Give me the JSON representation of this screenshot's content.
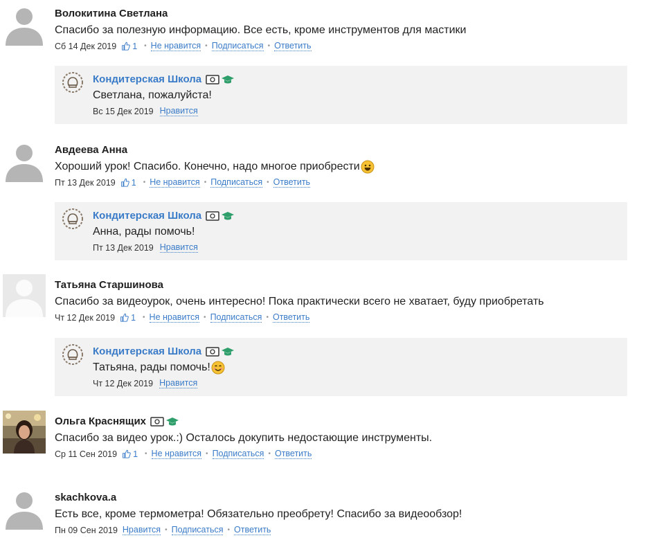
{
  "comments": [
    {
      "author": "Волокитина Светлана",
      "text": "Спасибо за полезную информацию. Все есть, кроме инструментов для мастики",
      "date": "Сб 14 Дек 2019",
      "likes": "1",
      "dislike_label": "Не нравится",
      "subscribe_label": "Подписаться",
      "reply_label": "Ответить",
      "reply": {
        "author": "Кондитерская Школа",
        "text": "Светлана, пожалуйста!",
        "date": "Вс 15 Дек 2019",
        "like_label": "Нравится"
      }
    },
    {
      "author": "Авдеева Анна",
      "text": "Хороший урок! Спасибо. Конечно, надо многое приобрести",
      "date": "Пт 13 Дек 2019",
      "likes": "1",
      "dislike_label": "Не нравится",
      "subscribe_label": "Подписаться",
      "reply_label": "Ответить",
      "reply": {
        "author": "Кондитерская Школа",
        "text": "Анна, рады помочь!",
        "date": "Пт 13 Дек 2019",
        "like_label": "Нравится"
      }
    },
    {
      "author": "Татьяна Старшинова",
      "text": "Спасибо за видеоурок, очень интересно! Пока практически всего не хватает, буду приобретать",
      "date": "Чт 12 Дек 2019",
      "likes": "1",
      "dislike_label": "Не нравится",
      "subscribe_label": "Подписаться",
      "reply_label": "Ответить",
      "reply": {
        "author": "Кондитерская Школа",
        "text": "Татьяна, рады помочь!",
        "date": "Чт 12 Дек 2019",
        "like_label": "Нравится"
      }
    },
    {
      "author": "Ольга Краснящих",
      "text": "Спасибо за видео урок.:) Осталось докупить недостающие инструменты.",
      "date": "Ср 11 Сен 2019",
      "likes": "1",
      "dislike_label": "Не нравится",
      "subscribe_label": "Подписаться",
      "reply_label": "Ответить"
    },
    {
      "author": "skachkova.a",
      "text": "Есть все, кроме термометра! Обязательно преобрету! Спасибо за видеообзор!",
      "date": "Пн 09 Сен 2019",
      "like_label": "Нравится",
      "subscribe_label": "Подписаться",
      "reply_label": "Ответить"
    }
  ],
  "colors": {
    "link": "#3a7bc8",
    "reply_bg": "#f2f2f2",
    "badge_green": "#2e9e6a",
    "avatar_gray": "#b5b5b5"
  }
}
